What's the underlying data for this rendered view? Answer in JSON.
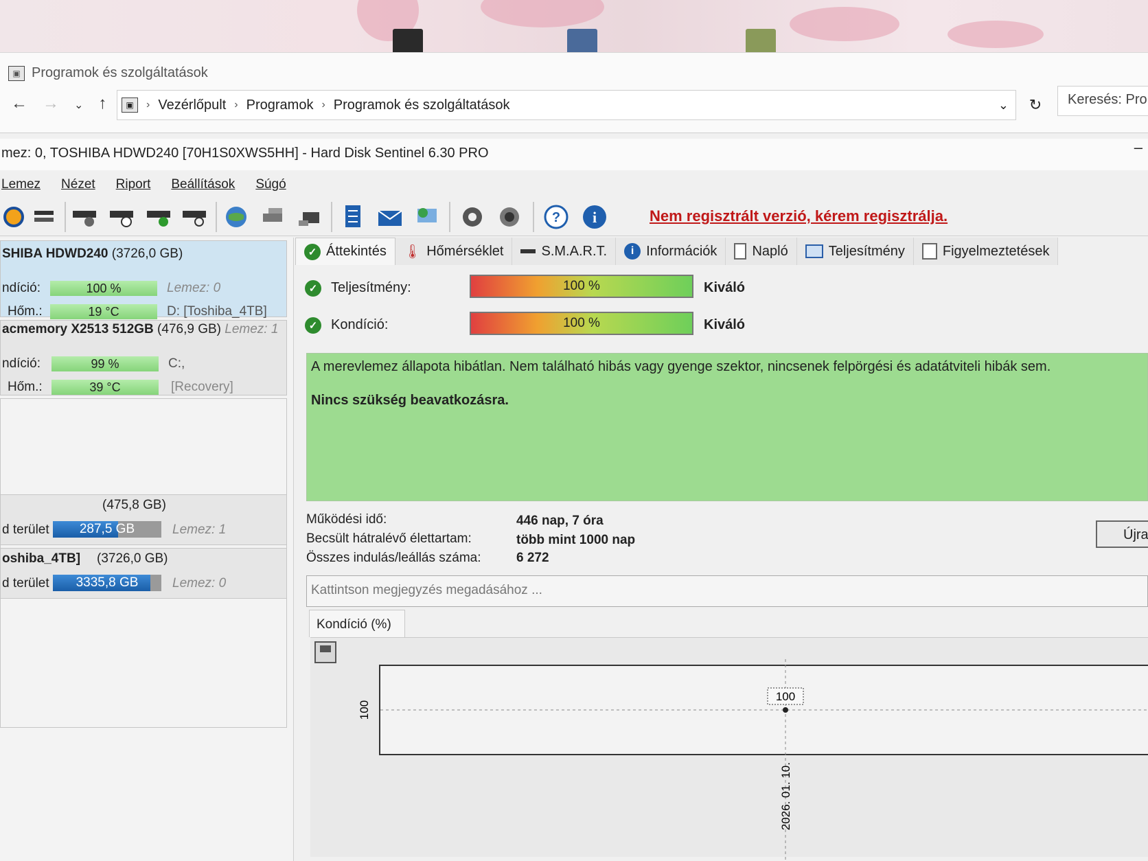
{
  "explorer": {
    "title": "Programok és szolgáltatások",
    "breadcrumb": [
      "Vezérlőpult",
      "Programok",
      "Programok és szolgáltatások"
    ],
    "search_placeholder": "Keresés: Pro"
  },
  "app": {
    "title": "mez: 0, TOSHIBA HDWD240 [70H1S0XWS5HH]  -  Hard Disk Sentinel 6.30 PRO",
    "menu": [
      "Lemez",
      "Nézet",
      "Riport",
      "Beállítások",
      "Súgó"
    ],
    "register_link": "Nem regisztrált verzió, kérem regisztrálja."
  },
  "disks": [
    {
      "name": "SHIBA HDWD240",
      "size": "(3726,0 GB)",
      "cond_label": "ndíció:",
      "cond": "100 %",
      "cond_frac": 1.0,
      "disk_label": "Lemez: 0",
      "temp_label": "Hőm.:",
      "temp": "19 °C",
      "partition": "D: [Toshiba_4TB]"
    },
    {
      "name": "acmemory X2513 512GB",
      "size": "(476,9 GB)",
      "disk_label": "Lemez: 1",
      "cond_label": "ndíció:",
      "cond": "99 %",
      "cond_frac": 0.99,
      "partition": "C:,",
      "temp_label": "Hőm.:",
      "temp": "39 °C",
      "partition2": "[Recovery]"
    }
  ],
  "volumes": [
    {
      "name": "",
      "size": "(475,8 GB)",
      "free_label": "d terület",
      "free": "287,5 GB",
      "free_frac": 0.6,
      "disk_label": "Lemez: 1"
    },
    {
      "name": "oshiba_4TB]",
      "size": "(3726,0 GB)",
      "free_label": "d terület",
      "free": "3335,8 GB",
      "free_frac": 0.9,
      "disk_label": "Lemez: 0"
    }
  ],
  "tabs": [
    "Áttekintés",
    "Hőmérséklet",
    "S.M.A.R.T.",
    "Információk",
    "Napló",
    "Teljesítmény",
    "Figyelmeztetések"
  ],
  "overview": {
    "perf_label": "Teljesítmény:",
    "perf_value": "100 %",
    "perf_rating": "Kiváló",
    "cond_label": "Kondíció:",
    "cond_value": "100 %",
    "cond_rating": "Kiváló",
    "status_text": "A merevlemez állapota hibátlan. Nem található hibás vagy gyenge szektor, nincsenek felpörgési és adatátviteli hibák sem.",
    "status_action": "Nincs szükség beavatkozásra.",
    "uptime_label": "Működési idő:",
    "uptime": "446 nap, 7 óra",
    "life_label": "Becsült hátralévő élettartam:",
    "life": "több mint 1000 nap",
    "starts_label": "Összes indulás/leállás száma:",
    "starts": "6 272",
    "retry_button": "Újra",
    "note_placeholder": "Kattintson megjegyzés megadásához ..."
  },
  "chart_tab": "Kondíció  (%)",
  "chart_data": {
    "type": "line",
    "title": "Kondíció  (%)",
    "x": [
      "2026. 01. 10."
    ],
    "series": [
      {
        "values": [
          100
        ]
      }
    ],
    "y_tick": "100",
    "point_label": "100",
    "grid": true
  }
}
